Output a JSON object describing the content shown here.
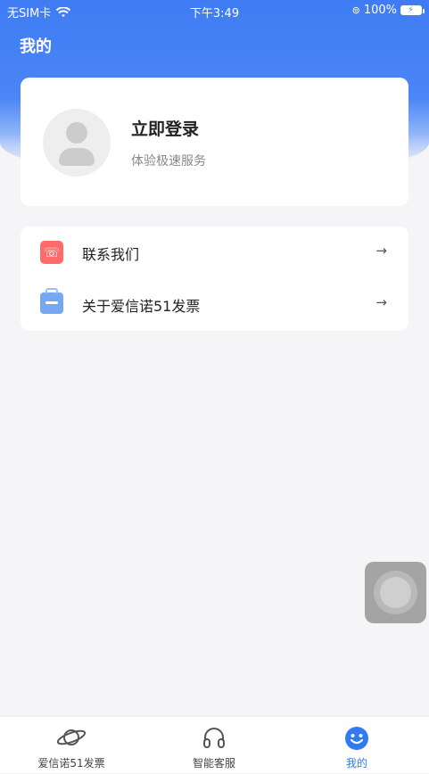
{
  "status_bar": {
    "carrier": "无SIM卡",
    "time": "下午3:49",
    "battery": "100%"
  },
  "header": {
    "title": "我的"
  },
  "profile": {
    "login_title": "立即登录",
    "login_subtitle": "体验极速服务"
  },
  "menu": {
    "items": [
      {
        "label": "联系我们",
        "icon": "phone-icon"
      },
      {
        "label": "关于爱信诺51发票",
        "icon": "briefcase-icon"
      }
    ],
    "arrow": "→"
  },
  "tabbar": {
    "tabs": [
      {
        "label": "爱信诺51发票",
        "icon": "planet-icon"
      },
      {
        "label": "智能客服",
        "icon": "headset-icon"
      },
      {
        "label": "我的",
        "icon": "smile-icon"
      }
    ],
    "active_color": "#2f7bf5"
  },
  "colors": {
    "brand_blue": "#3f7cf4"
  }
}
